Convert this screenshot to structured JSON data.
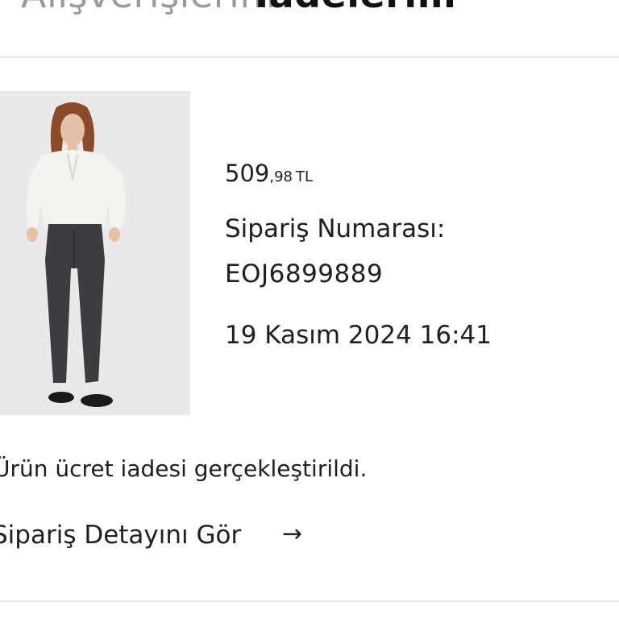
{
  "tabs": {
    "inactive_label": "Alışverişlerim",
    "active_label": "İadelerim"
  },
  "order": {
    "price_main": "509",
    "price_cents": ",98",
    "currency": "TL",
    "order_number_label": "Sipariş Numarası:",
    "order_number": "EOJ6899889",
    "date": "19 Kasım 2024 16:41",
    "refund_message": "Ürün ücret iadesi gerçekleştirildi.",
    "detail_link_label": "Sipariş Detayını Gör",
    "detail_link_icon": "arrow-right-icon"
  },
  "colors": {
    "text": "#1f1f1f",
    "inactive_tab": "#9a9a9a",
    "divider": "#e6e6e6",
    "image_background": "#e9e9e9"
  }
}
